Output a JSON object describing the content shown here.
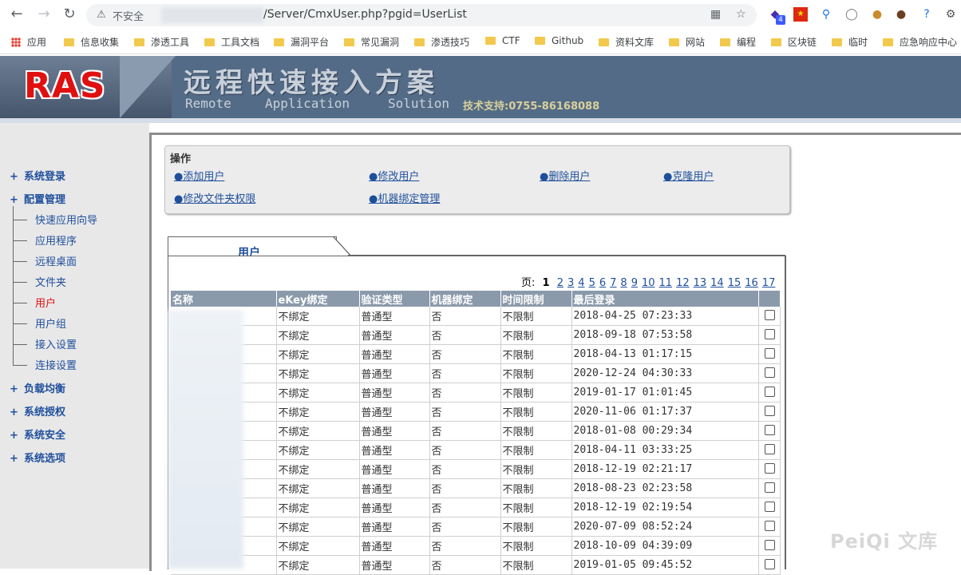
{
  "browser": {
    "insecure_label": "不安全",
    "url_path": "/Server/CmxUser.php?pgid=UserList",
    "ext_badge": "4",
    "bookmarks": [
      "应用",
      "信息收集",
      "渗透工具",
      "工具文档",
      "漏洞平台",
      "常见漏洞",
      "渗透技巧",
      "CTF",
      "Github",
      "资料文库",
      "网站",
      "编程",
      "区块链",
      "临时",
      "应急响应中心"
    ]
  },
  "banner": {
    "logo": "RAS",
    "title": "远程快速接入方案",
    "sub_words": [
      "Remote",
      "Application",
      "Solution"
    ],
    "support": "技术支持:0755-86168088"
  },
  "nav": {
    "items": [
      {
        "label": "系统登录"
      },
      {
        "label": "配置管理"
      },
      {
        "label": "负载均衡"
      },
      {
        "label": "系统授权"
      },
      {
        "label": "系统安全"
      },
      {
        "label": "系统选项"
      }
    ],
    "sub_items": [
      {
        "label": "快速应用向导"
      },
      {
        "label": "应用程序"
      },
      {
        "label": "远程桌面"
      },
      {
        "label": "文件夹"
      },
      {
        "label": "用户"
      },
      {
        "label": "用户组"
      },
      {
        "label": "接入设置"
      },
      {
        "label": "连接设置"
      }
    ]
  },
  "ops": {
    "title": "操作",
    "links": [
      "●添加用户",
      "●修改用户",
      "●删除用户",
      "●克隆用户",
      "●修改文件夹权限",
      "●机器绑定管理"
    ]
  },
  "tab_label": "用户",
  "pager": {
    "label": "页:",
    "current": "1",
    "pages": [
      "2",
      "3",
      "4",
      "5",
      "6",
      "7",
      "8",
      "9",
      "10",
      "11",
      "12",
      "13",
      "14",
      "15",
      "16",
      "17"
    ]
  },
  "table": {
    "headers": [
      "名称",
      "eKey绑定",
      "验证类型",
      "机器绑定",
      "时间限制",
      "最后登录"
    ],
    "rows": [
      {
        "ekey": "不绑定",
        "auth": "普通型",
        "bind": "否",
        "limit": "不限制",
        "last": "2018-04-25 07:23:33"
      },
      {
        "ekey": "不绑定",
        "auth": "普通型",
        "bind": "否",
        "limit": "不限制",
        "last": "2018-09-18 07:53:58"
      },
      {
        "ekey": "不绑定",
        "auth": "普通型",
        "bind": "否",
        "limit": "不限制",
        "last": "2018-04-13 01:17:15"
      },
      {
        "ekey": "不绑定",
        "auth": "普通型",
        "bind": "否",
        "limit": "不限制",
        "last": "2020-12-24 04:30:33"
      },
      {
        "ekey": "不绑定",
        "auth": "普通型",
        "bind": "否",
        "limit": "不限制",
        "last": "2019-01-17 01:01:45"
      },
      {
        "ekey": "不绑定",
        "auth": "普通型",
        "bind": "否",
        "limit": "不限制",
        "last": "2020-11-06 01:17:37"
      },
      {
        "ekey": "不绑定",
        "auth": "普通型",
        "bind": "否",
        "limit": "不限制",
        "last": "2018-01-08 00:29:34"
      },
      {
        "ekey": "不绑定",
        "auth": "普通型",
        "bind": "否",
        "limit": "不限制",
        "last": "2018-04-11 03:33:25"
      },
      {
        "ekey": "不绑定",
        "auth": "普通型",
        "bind": "否",
        "limit": "不限制",
        "last": "2018-12-19 02:21:17"
      },
      {
        "ekey": "不绑定",
        "auth": "普通型",
        "bind": "否",
        "limit": "不限制",
        "last": "2018-08-23 02:23:58"
      },
      {
        "ekey": "不绑定",
        "auth": "普通型",
        "bind": "否",
        "limit": "不限制",
        "last": "2018-12-19 02:19:54"
      },
      {
        "ekey": "不绑定",
        "auth": "普通型",
        "bind": "否",
        "limit": "不限制",
        "last": "2020-07-09 08:52:24"
      },
      {
        "ekey": "不绑定",
        "auth": "普通型",
        "bind": "否",
        "limit": "不限制",
        "last": "2018-10-09 04:39:09"
      },
      {
        "ekey": "不绑定",
        "auth": "普通型",
        "bind": "否",
        "limit": "不限制",
        "last": "2019-01-05 09:45:52"
      }
    ]
  },
  "watermark": "PeiQi 文库",
  "colors": {
    "banner": "#536b86",
    "link": "#1e4f9c",
    "active": "#e01010",
    "table_header": "#8b9aab"
  }
}
